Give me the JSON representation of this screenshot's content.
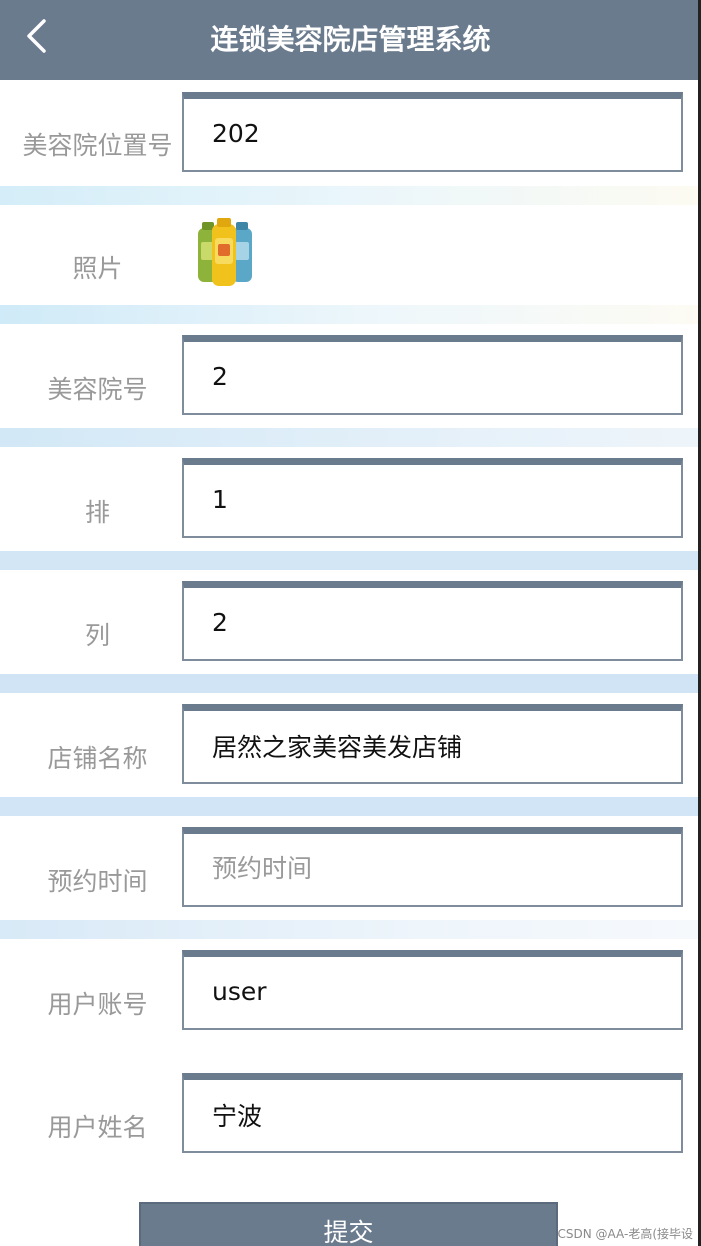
{
  "header": {
    "title": "连锁美容院店管理系统",
    "back_icon": "chevron-left-icon"
  },
  "form": {
    "fields": [
      {
        "label": "美容院位置号",
        "value": "202",
        "placeholder": ""
      },
      {
        "label": "照片",
        "type": "image",
        "image_icon": "shampoo-bottles-image"
      },
      {
        "label": "美容院号",
        "value": "2",
        "placeholder": ""
      },
      {
        "label": "排",
        "value": "1",
        "placeholder": ""
      },
      {
        "label": "列",
        "value": "2",
        "placeholder": ""
      },
      {
        "label": "店铺名称",
        "value": "居然之家美容美发店铺",
        "placeholder": ""
      },
      {
        "label": "预约时间",
        "value": "",
        "placeholder": "预约时间"
      },
      {
        "label": "用户账号",
        "value": "user",
        "placeholder": ""
      },
      {
        "label": "用户姓名",
        "value": "宁波",
        "placeholder": ""
      }
    ],
    "submit_label": "提交"
  },
  "watermark": "CSDN @AA-老高(接毕设",
  "colors": {
    "header_bg": "#6b7b8e",
    "label_text": "#999999",
    "field_border": "#7f8c9c",
    "separator": "#d6e9f8"
  }
}
